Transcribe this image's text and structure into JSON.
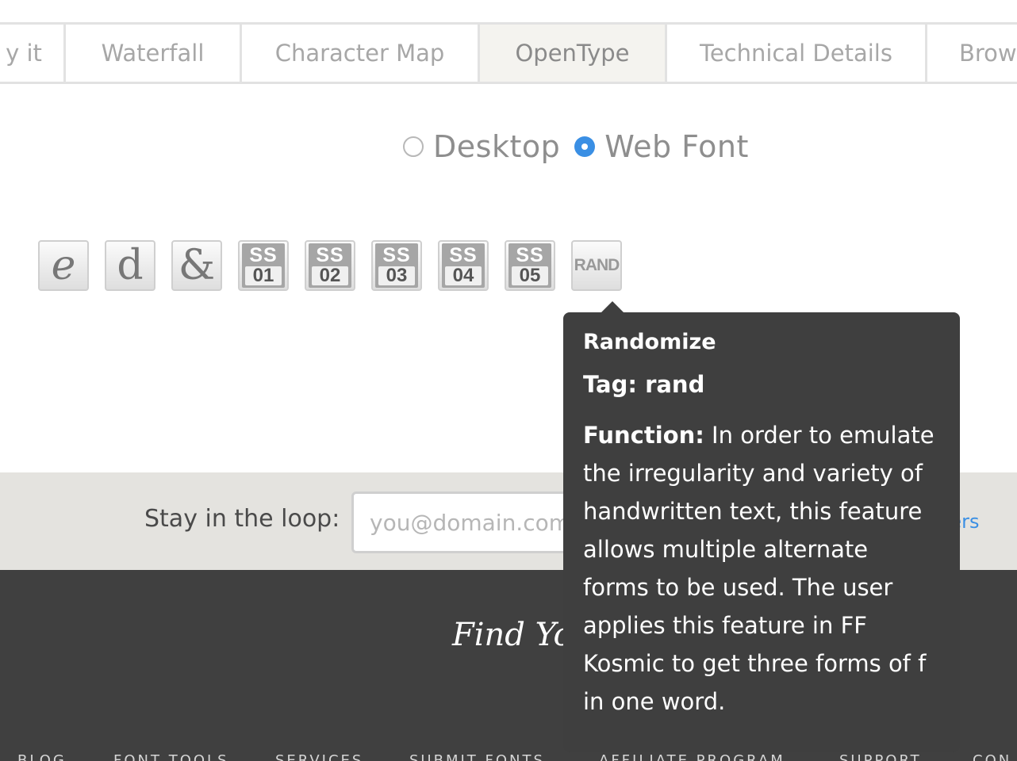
{
  "tabs": [
    {
      "label": "y it",
      "active": false
    },
    {
      "label": "Waterfall",
      "active": false
    },
    {
      "label": "Character Map",
      "active": false
    },
    {
      "label": "OpenType",
      "active": true
    },
    {
      "label": "Technical Details",
      "active": false
    },
    {
      "label": "Brow",
      "active": false
    }
  ],
  "format": {
    "desktop_label": "Desktop",
    "webfont_label": "Web Font",
    "selected": "Web Font"
  },
  "features": {
    "glyph_buttons": [
      "e",
      "d",
      "&"
    ],
    "stylistic_sets": [
      {
        "top": "SS",
        "num": "01"
      },
      {
        "top": "SS",
        "num": "02"
      },
      {
        "top": "SS",
        "num": "03"
      },
      {
        "top": "SS",
        "num": "04"
      },
      {
        "top": "SS",
        "num": "05"
      }
    ],
    "rand_label": "RAND"
  },
  "tooltip": {
    "title": "Randomize",
    "tag": "Tag: rand",
    "function_label": "Function:",
    "function_text": " In order to emulate the irregularity and variety of handwritten text, this feature allows multiple alternate forms to be used. The user applies this feature in FF Kosmic to get three forms of f in one word."
  },
  "newsletter": {
    "label": "Stay in the loop:",
    "placeholder": "you@domain.com",
    "link_fragment": "ters"
  },
  "footer": {
    "heading": "Find Yo",
    "nav": [
      "BLOG",
      "FONT TOOLS",
      "SERVICES",
      "SUBMIT FONTS",
      "AFFILIATE PROGRAM",
      "SUPPORT",
      "CON"
    ]
  },
  "colors": {
    "accent": "#3a8fe4",
    "tooltip_bg": "#3f3f3f",
    "footer_bg": "#404040",
    "newsletter_bg": "#e4e3df"
  }
}
